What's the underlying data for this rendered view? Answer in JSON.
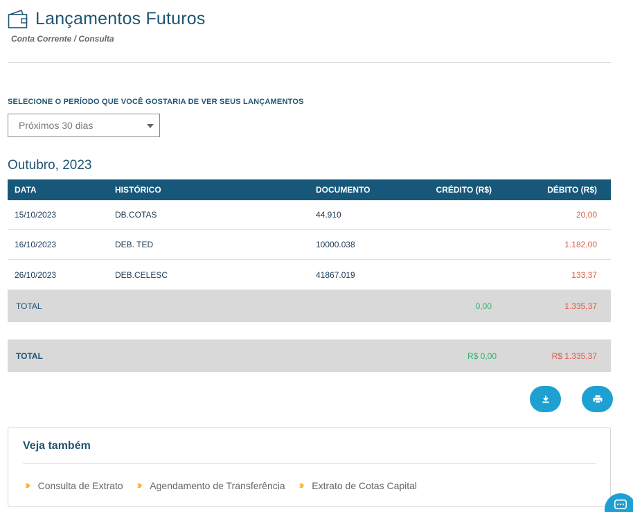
{
  "header": {
    "title": "Lançamentos Futuros",
    "breadcrumb": "Conta Corrente / Consulta",
    "icon": "wallet-icon"
  },
  "period": {
    "label": "SELECIONE O PERÍODO QUE VOCÊ GOSTARIA DE VER SEUS LANÇAMENTOS",
    "selected": "Próximos 30 dias"
  },
  "month": {
    "title": "Outubro, 2023",
    "columns": {
      "data": "DATA",
      "historico": "HISTÓRICO",
      "documento": "DOCUMENTO",
      "credito": "CRÉDITO (R$)",
      "debito": "DÉBITO (R$)"
    },
    "rows": [
      {
        "data": "15/10/2023",
        "historico": "DB.COTAS",
        "documento": "44.910",
        "credito": "",
        "debito": "20,00"
      },
      {
        "data": "16/10/2023",
        "historico": "DEB. TED",
        "documento": "10000.038",
        "credito": "",
        "debito": "1.182,00"
      },
      {
        "data": "26/10/2023",
        "historico": "DEB.CELESC",
        "documento": "41867.019",
        "credito": "",
        "debito": "133,37"
      }
    ],
    "total": {
      "label": "TOTAL",
      "credito": "0,00",
      "debito": "1.335,37"
    }
  },
  "grand_total": {
    "label": "TOTAL",
    "credito": "R$ 0,00",
    "debito": "R$ 1.335,37"
  },
  "actions": {
    "download_icon": "download-icon",
    "print_icon": "print-icon"
  },
  "see_also": {
    "title": "Veja também",
    "links": [
      "Consulta de Extrato",
      "Agendamento de Transferência",
      "Extrato de Cotas Capital"
    ]
  },
  "colors": {
    "primary": "#17587a",
    "accent": "#1fa0d2",
    "credit": "#2fb36a",
    "debit": "#e05a47",
    "chevron": "#f0a830"
  }
}
